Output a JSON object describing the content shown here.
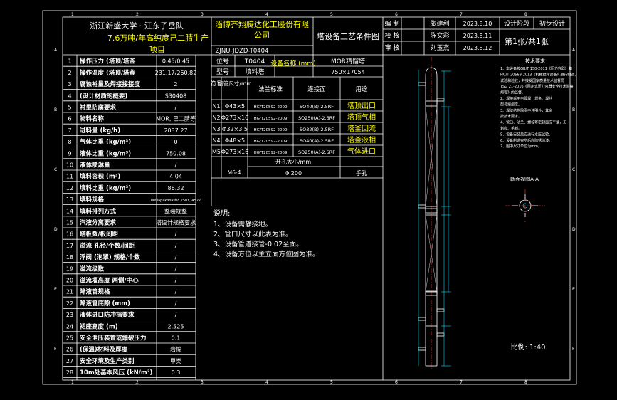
{
  "header": {
    "company_left": "浙江新盛大学 · 江东子岳队",
    "project_line": "7.6万吨/年高纯度己二腈生产",
    "project_line2": "项目",
    "company_right": "淄博齐翔腾达化工股份有限",
    "company_right2": "公司",
    "doc_no": "ZJNU-JDZD-T0404",
    "drawing_title": "塔设备工艺条件图",
    "sign_rows": [
      {
        "role": "编",
        "role2": "制",
        "name": "张建利",
        "date": "2023.8.10"
      },
      {
        "role": "校",
        "role2": "核",
        "name": "陈文彩",
        "date": "2023.8.11"
      },
      {
        "role": "审",
        "role2": "核",
        "name": "刘玉杰",
        "date": "2023.8.12"
      }
    ],
    "stage_label": "设计阶段",
    "stage_value": "初步设计",
    "sheet": "第1张/共1张"
  },
  "params_table": [
    {
      "no": "1",
      "name": "操作压力 (塔顶/塔釜",
      "value": "0.45/0.45"
    },
    {
      "no": "2",
      "name": "操作温度 (塔顶/塔釜",
      "value": "231.17/260.82"
    },
    {
      "no": "3",
      "name": "腐蚀裕量及焊接接接度",
      "value": "2"
    },
    {
      "no": "4",
      "name": "(设计材质的概要)",
      "value": "S30408"
    },
    {
      "no": "5",
      "name": "衬里防腐要求",
      "value": "/"
    },
    {
      "no": "6",
      "name": "物料名称",
      "value": "MOR, 己二腈等"
    },
    {
      "no": "7",
      "name": "进料量 (kg/h)",
      "value": "2037.27"
    },
    {
      "no": "8",
      "name": "气体比重 (kg/m³)",
      "value": "0"
    },
    {
      "no": "9",
      "name": "液体比重 (kg/m³)",
      "value": "750.08"
    },
    {
      "no": "10",
      "name": "液体喷淋量",
      "value": "/"
    },
    {
      "no": "11",
      "name": "填料容积 (m³)",
      "value": "4.04"
    },
    {
      "no": "12",
      "name": "填料比重 (kg/m³)",
      "value": "86.32"
    },
    {
      "no": "13",
      "name": "填料规格",
      "value": "Mellapak/Plastic 250Y, 4527"
    },
    {
      "no": "14",
      "name": "填料排列方式",
      "value": "整装规整"
    },
    {
      "no": "15",
      "name": "汽液分离要求",
      "value": "塔设计规格要求"
    },
    {
      "no": "16",
      "name": "塔板数/板间距",
      "value": "/"
    },
    {
      "no": "17",
      "name": "溢流 孔径/个数/间距",
      "value": "/"
    },
    {
      "no": "18",
      "name": "浮阀 (泡罩) 规格/个数",
      "value": "/"
    },
    {
      "no": "19",
      "name": "溢流级数",
      "value": "/"
    },
    {
      "no": "20",
      "name": "溢流堰高度 两侧/中心",
      "value": "/"
    },
    {
      "no": "21",
      "name": "降液管规格",
      "value": "/"
    },
    {
      "no": "22",
      "name": "降液管底隙 (mm)",
      "value": "/"
    },
    {
      "no": "23",
      "name": "液体进口防冲挡要求",
      "value": "/"
    },
    {
      "no": "24",
      "name": "裙座高度 (m)",
      "value": "2.525"
    },
    {
      "no": "25",
      "name": "安全泄压装置或爆破压力",
      "value": "0.1"
    },
    {
      "no": "26",
      "name": "(保温)材料及厚度",
      "value": "岩棉"
    },
    {
      "no": "27",
      "name": "安全环境及生产类别",
      "value": "甲类"
    },
    {
      "no": "28",
      "name": "10m处基本风压 (kN/m²)",
      "value": "0.3"
    }
  ],
  "equip_info": {
    "tag_label": "位号",
    "tag_value": "T0404",
    "size_label": "设备名称 (mm)",
    "name_value": "MOR精馏塔",
    "type_label": "型号",
    "type_value": "填料塔",
    "dims": "750×17054"
  },
  "nozzle_headers": {
    "mark": "符号",
    "size": "接管尺寸/mm",
    "std": "法兰标准",
    "face": "连接面",
    "use": "用途"
  },
  "nozzles": [
    {
      "mark": "N1",
      "size": "Φ43×5",
      "std": "HG/T20592-2009",
      "face": "SO40(B)-2.5RF",
      "use": "塔顶出口"
    },
    {
      "mark": "N2",
      "size": "Φ273×16",
      "std": "HG/T20592-2009",
      "face": "SO250(A)-2.5RF",
      "use": "塔顶气相"
    },
    {
      "mark": "N3",
      "size": "Φ32×3.5",
      "std": "HG/T20592-2009",
      "face": "SO32(B)-2.5RF",
      "use": "塔釜回流"
    },
    {
      "mark": "N4",
      "size": "Φ48×5",
      "std": "HG/T20592-2009",
      "face": "SO40(A)-2.5RF",
      "use": "塔釜液相"
    },
    {
      "mark": "M5",
      "size": "Φ273×16",
      "std": "HG/T20592-2009",
      "face": "SO250(A)-2.5RF",
      "use": "气体进口"
    }
  ],
  "manhole": {
    "header": "开孔大小/mm",
    "mark": "M6-4",
    "size": "Φ 200",
    "use": "手孔"
  },
  "notes": {
    "title": "说明:",
    "lines": [
      "1、设备需静接地。",
      "2、管口尺寸以此表为准。",
      "3、设备管道接管-0.02至面。",
      "4、设备方位以主立面方位图为准。"
    ]
  },
  "tech_req": {
    "title": "技术要求",
    "lines": [
      "1、本设备按GB/T 150-2011《压力容器》和",
      "HG/T 20569-2013《机械搅拌设备》进行制造、",
      "试验和验收，并接受国家质量技术监督局",
      "TSG 21-2016《固定式压力容器安全技术监察",
      "规程》的监督。",
      "2、焊接采用电弧焊，焊条、焊丝",
      "型号按规定。",
      "3、焊缝结构除图中注明外，其余",
      "按技术要求。",
      "4、管口、法兰、螺栓等密封面应平整，无",
      "划痕、毛刺。",
      "5、设备安装后应进行水压试验。",
      "6、设备制造完毕后应除锈涂漆。",
      "7、图中尺寸单位为mm。"
    ]
  },
  "section_label": "断面视图A-A",
  "scale": "比例: 1:40",
  "border": {
    "top_nums": [
      "1",
      "2",
      "3",
      "4",
      "5",
      "6",
      "7",
      "8"
    ],
    "side_letters": [
      "A",
      "B",
      "C",
      "D",
      "E",
      "F"
    ]
  },
  "colors": {
    "background": "#000000",
    "line": "#ffffff",
    "text_primary": "#ffffff",
    "text_highlight": "#ffff00",
    "centerline": "#ff4040",
    "dimension": "#00ff00"
  }
}
